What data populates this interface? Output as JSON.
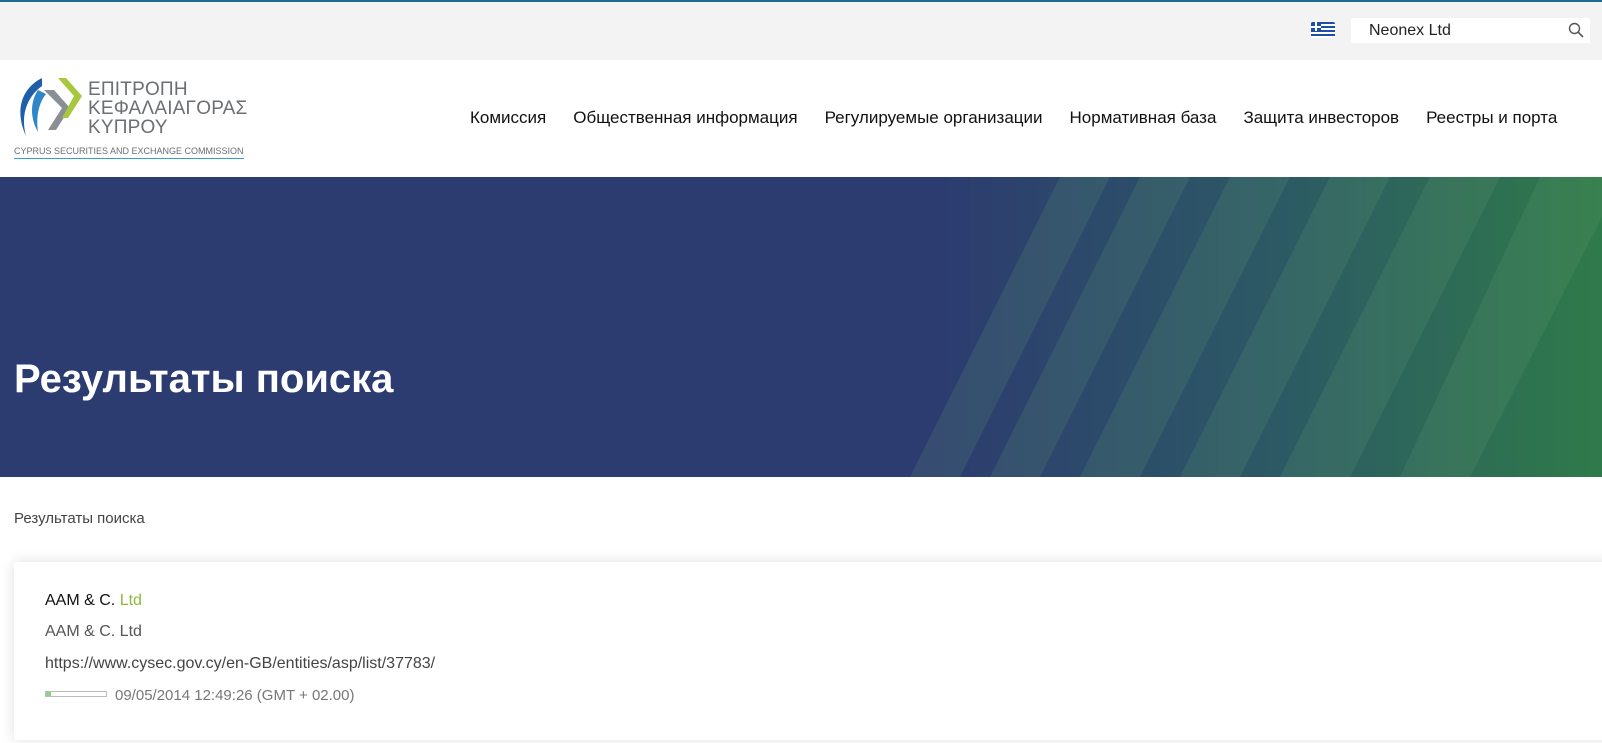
{
  "topbar": {
    "language_flag": "greek-flag-icon",
    "search": {
      "value": "Neonex Ltd",
      "icon": "search-icon"
    }
  },
  "header": {
    "logo": {
      "lines": [
        "ΕΠΙΤΡΟΠΗ",
        "ΚΕΦΑΛΑΙΑΓΟΡΑΣ",
        "ΚΥΠΡΟΥ"
      ],
      "subtitle": "CYPRUS SECURITIES AND EXCHANGE COMMISSION",
      "colors": {
        "blue": "#1f5fa8",
        "green": "#a7c83d",
        "gray": "#8a8f94"
      }
    },
    "nav": [
      {
        "label": "Комиссия"
      },
      {
        "label": "Общественная информация"
      },
      {
        "label": "Регулируемые организации"
      },
      {
        "label": "Нормативная база"
      },
      {
        "label": "Защита инвесторов"
      },
      {
        "label": "Реестры и порта"
      }
    ]
  },
  "hero": {
    "title": "Результаты поиска",
    "colors": {
      "base": "#2c3b70",
      "accent": "#2f7a4a"
    }
  },
  "breadcrumb": {
    "current": "Результаты поиска"
  },
  "results": [
    {
      "title_main": "AAM & C.",
      "title_highlight": "Ltd",
      "description": "AAM & C. Ltd",
      "url": "https://www.cysec.gov.cy/en-GB/entities/asp/list/37783/",
      "relevance": 0.08,
      "date": "09/05/2014 12:49:26 (GMT + 02.00)"
    }
  ]
}
